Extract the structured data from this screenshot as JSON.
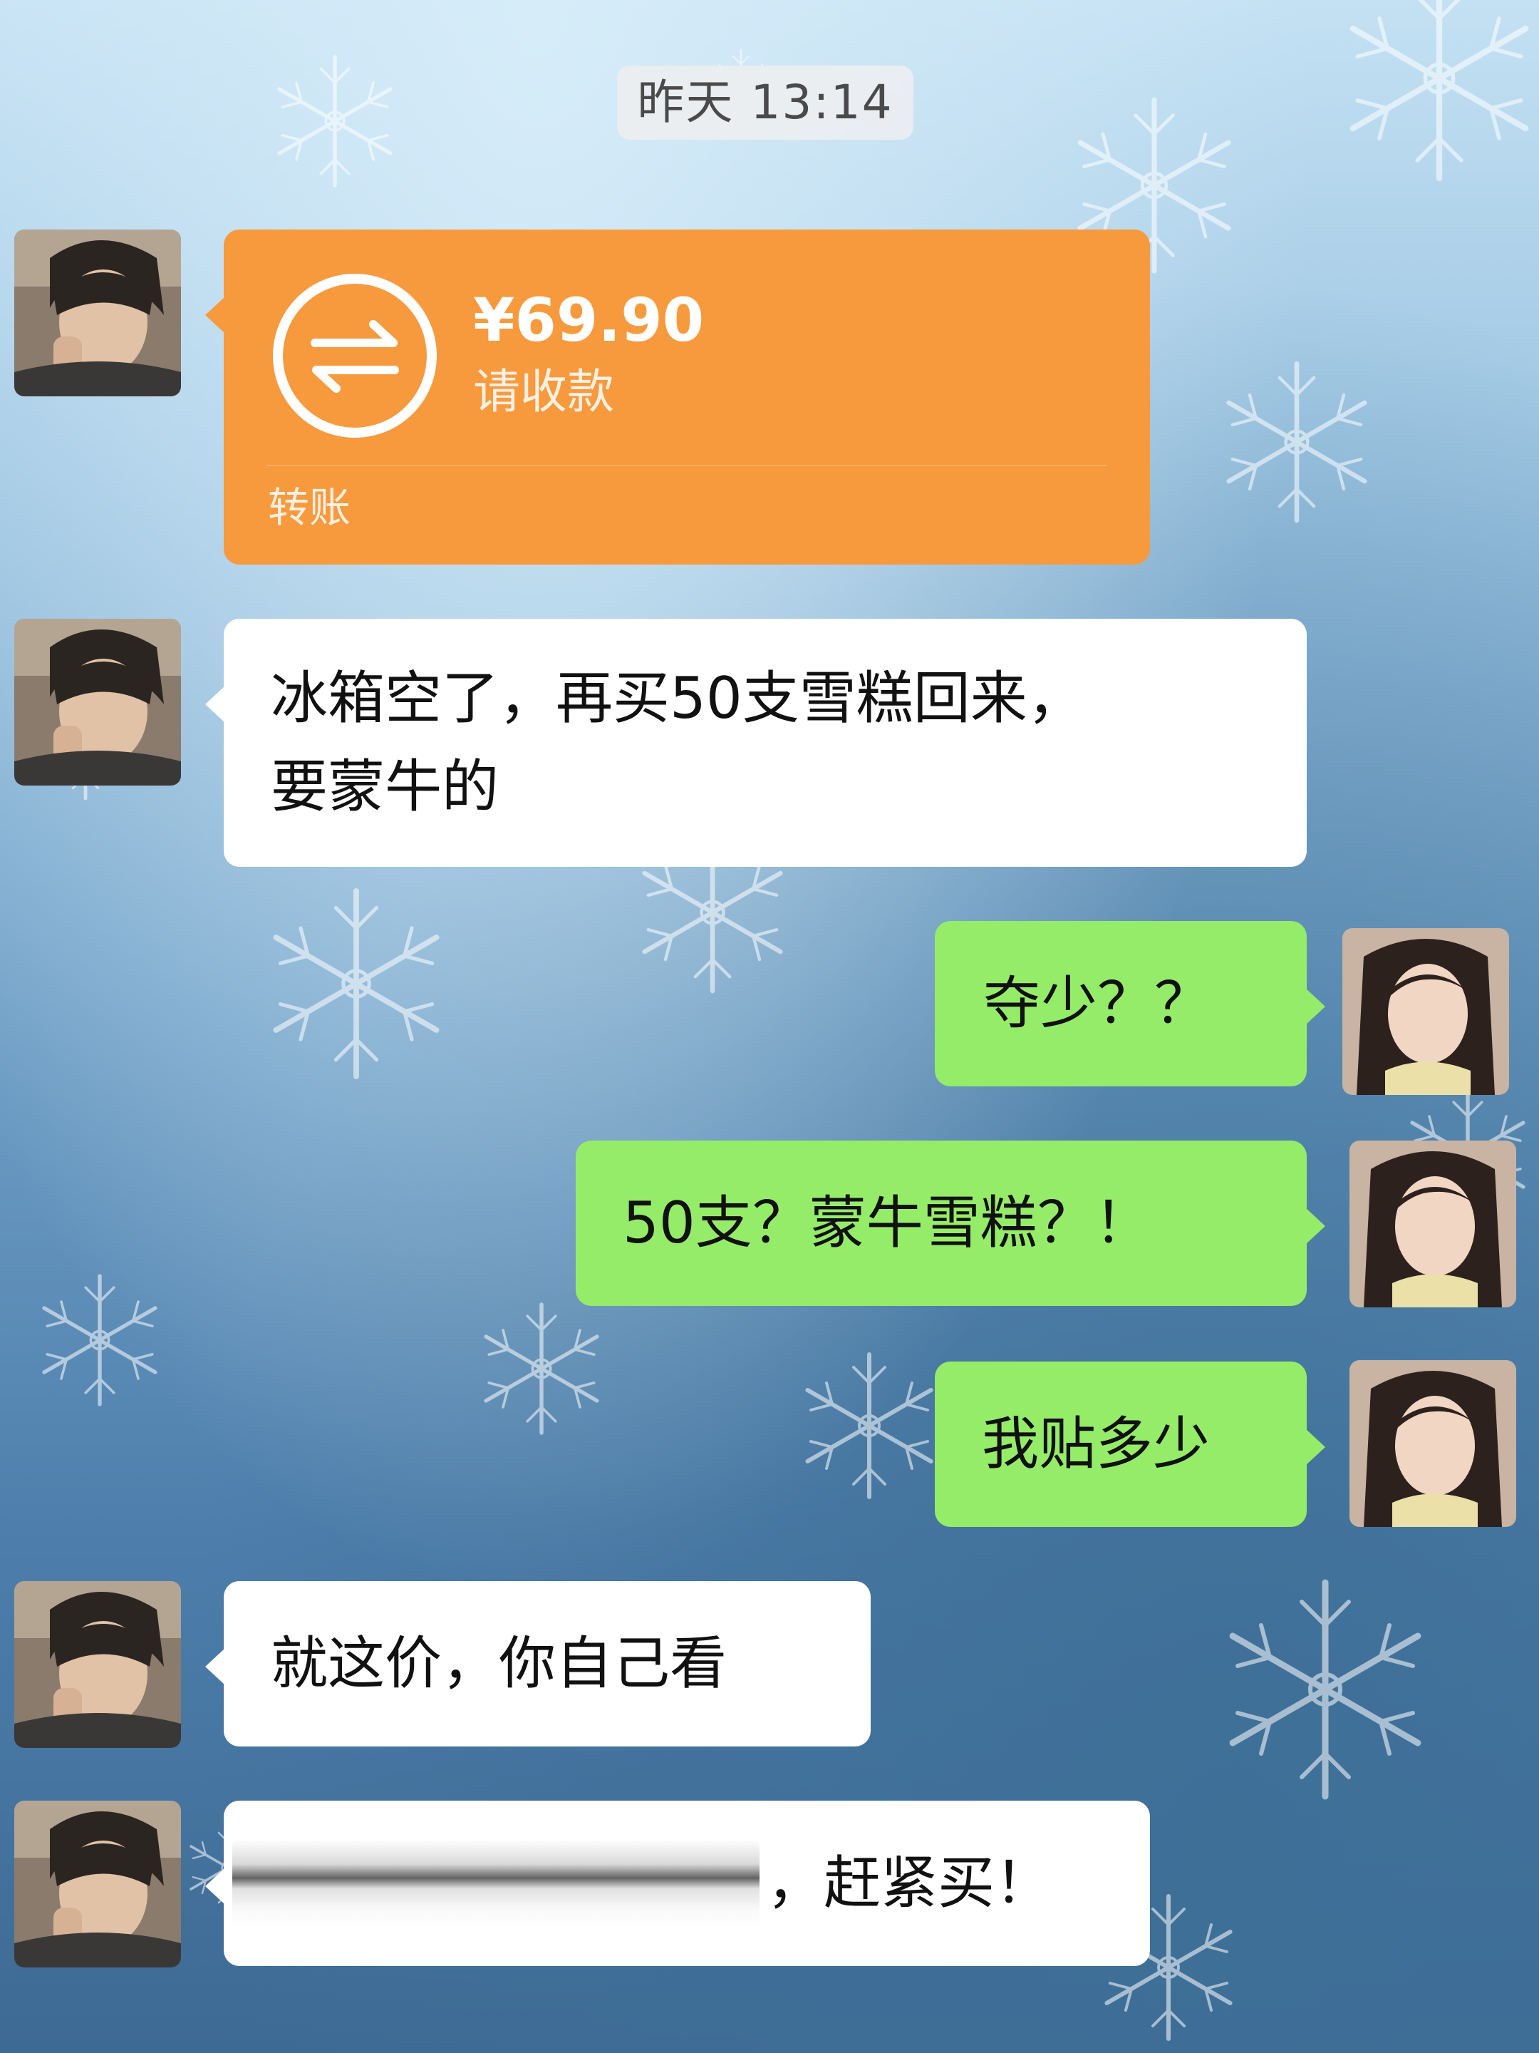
{
  "chat": {
    "timestamp": "昨天 13:14",
    "transfer": {
      "amount": "¥69.90",
      "status": "请收款",
      "footer": "转账",
      "icon": "transfer-arrows-icon",
      "color": "#f79a3e"
    },
    "messages": [
      {
        "sender": "contact",
        "text": "冰箱空了，再买50支雪糕回来，"
      },
      {
        "sender": "contact",
        "text": "要蒙牛的"
      },
      {
        "sender": "me",
        "text": "夺少？？"
      },
      {
        "sender": "me",
        "text": "50支？蒙牛雪糕？！"
      },
      {
        "sender": "me",
        "text": "我贴多少"
      },
      {
        "sender": "contact",
        "text": "就这价，你自己看"
      },
      {
        "sender": "contact",
        "text": "，赶紧买！"
      }
    ]
  },
  "colors": {
    "my_bubble": "#95ec69",
    "contact_bubble": "#ffffff",
    "transfer_card": "#f79a3e"
  }
}
